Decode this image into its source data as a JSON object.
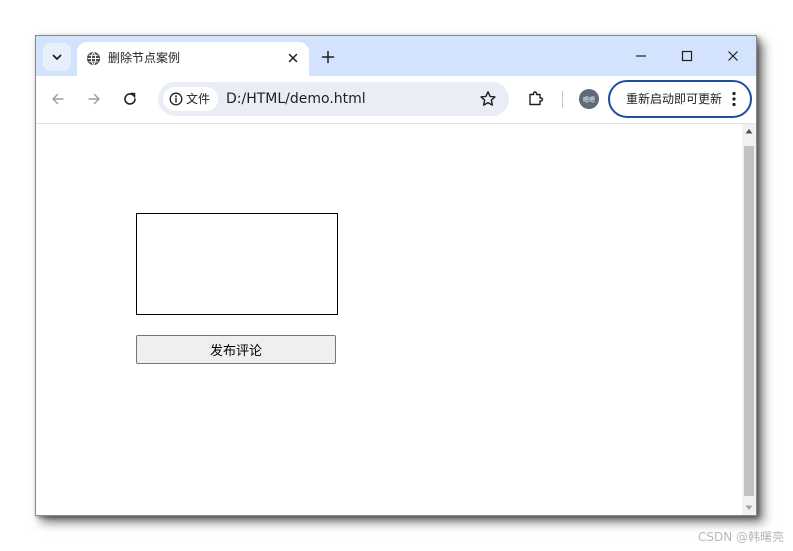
{
  "browser": {
    "tab": {
      "title": "删除节点案例",
      "favicon": "globe-icon",
      "close_icon": "close-icon"
    },
    "new_tab_icon": "plus-icon",
    "window_controls": [
      "minimize-icon",
      "maximize-icon",
      "close-icon"
    ],
    "toolbar": {
      "back_icon": "arrow-left-icon",
      "forward_icon": "arrow-right-icon",
      "reload_icon": "reload-icon",
      "site_chip_label": "文件",
      "url": "D:/HTML/demo.html",
      "bookmark_icon": "star-icon",
      "extensions_icon": "puzzle-icon",
      "avatar_text": "嗯嗯",
      "update_label": "重新启动即可更新",
      "menu_icon": "kebab-icon"
    },
    "accent_color": "#d3e3fd",
    "update_border_color": "#1f4f9b"
  },
  "page": {
    "comment_textarea_value": "",
    "publish_button_label": "发布评论"
  },
  "watermark": "CSDN @韩曙亮"
}
